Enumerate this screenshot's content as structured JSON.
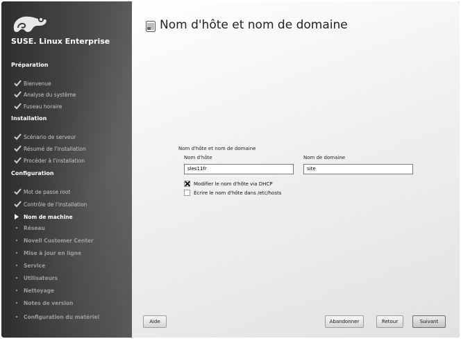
{
  "sidebar": {
    "brand": "SUSE. Linux Enterprise",
    "sections": [
      {
        "title": "Préparation",
        "steps": [
          {
            "label": "Bienvenue",
            "state": "done"
          },
          {
            "label": "Analyse du système",
            "state": "done"
          },
          {
            "label": "Fuseau horaire",
            "state": "done"
          }
        ]
      },
      {
        "title": "Installation",
        "steps": [
          {
            "label": "Scénario de serveur",
            "state": "done"
          },
          {
            "label": "Résumé de l'installation",
            "state": "done"
          },
          {
            "label": "Procéder à l'installation",
            "state": "done"
          }
        ]
      },
      {
        "title": "Configuration",
        "steps": [
          {
            "label": "Mot de passe root",
            "state": "done"
          },
          {
            "label": "Contrôle de l'installation",
            "state": "done"
          },
          {
            "label": "Nom de machine",
            "state": "current"
          },
          {
            "label": "Réseau",
            "state": "todo"
          },
          {
            "label": "Novell Customer Center",
            "state": "todo"
          },
          {
            "label": "Mise à jour en ligne",
            "state": "todo"
          },
          {
            "label": "Service",
            "state": "todo"
          },
          {
            "label": "Utilisateurs",
            "state": "todo"
          },
          {
            "label": "Nettoyage",
            "state": "todo"
          },
          {
            "label": "Notes de version",
            "state": "todo"
          },
          {
            "label": "Configuration du matériel",
            "state": "todo"
          }
        ]
      }
    ]
  },
  "main": {
    "title": "Nom d'hôte et nom de domaine",
    "group_label": "Nom d'hôte et nom de domaine",
    "hostname_label": "Nom d'hôte",
    "hostname_value": "sles11fr",
    "domain_label": "Nom de domaine",
    "domain_value": "site",
    "dhcp_checkbox_label": "Modifier le nom d'hôte via DHCP",
    "dhcp_checked": true,
    "hosts_checkbox_label": "Écrire le nom d'hôte dans /etc/hosts",
    "hosts_checked": false
  },
  "buttons": {
    "help": "Aide",
    "abort": "Abandonner",
    "back": "Retour",
    "next": "Suivant"
  },
  "colors": {
    "sidebar_bg": "#3e3e3e",
    "content_bg": "#f0f0f0",
    "done_check": "#d0d0d0"
  }
}
